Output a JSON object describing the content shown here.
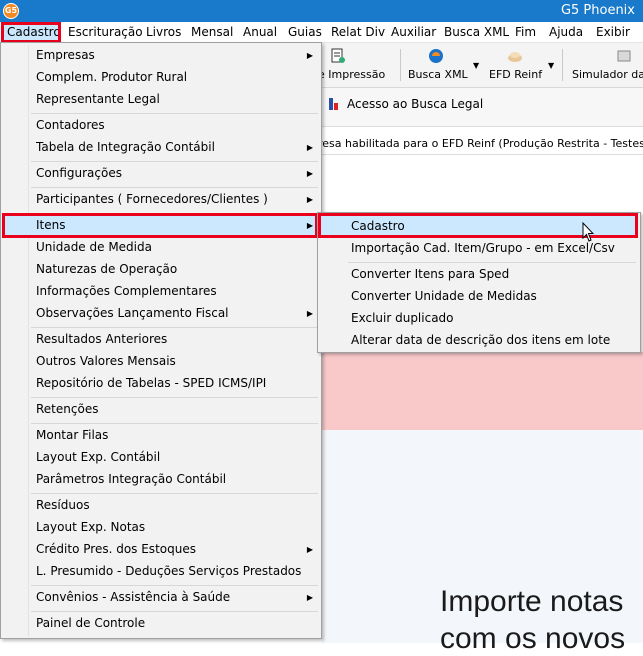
{
  "window": {
    "title": "G5 Phoenix",
    "app_icon_text": "G5"
  },
  "menubar": [
    {
      "label": "Cadastro",
      "active": true
    },
    {
      "label": "Escrituração"
    },
    {
      "label": "Livros"
    },
    {
      "label": "Mensal"
    },
    {
      "label": "Anual"
    },
    {
      "label": "Guias"
    },
    {
      "label": "Relat Div"
    },
    {
      "label": "Auxiliar"
    },
    {
      "label": "Busca XML"
    },
    {
      "label": "Fim"
    },
    {
      "label": "Ajuda"
    },
    {
      "label": "Exibir"
    }
  ],
  "toolbar": {
    "items": [
      {
        "label": "e Impressão",
        "icon": "print-setup-icon"
      },
      {
        "label": "Busca XML",
        "icon": "busca-xml-icon"
      },
      {
        "label": "EFD Reinf",
        "icon": "efd-reinf-icon"
      },
      {
        "label": "Simulador da R",
        "icon": "simulator-icon"
      }
    ],
    "busca_legal_label": "Acesso ao Busca Legal",
    "status_text": "resa habilitada para o EFD Reinf (Produção Restrita - Testes)"
  },
  "background": {
    "headline_line1": "Importe notas",
    "headline_line2": "com os novos"
  },
  "cadastro_menu": {
    "items": [
      {
        "label": "Empresas",
        "submenu": true
      },
      {
        "label": "Complem. Produtor Rural",
        "submenu": false
      },
      {
        "label": "Representante Legal",
        "submenu": false
      },
      {
        "label": "Contadores",
        "submenu": false
      },
      {
        "label": "Tabela de Integração Contábil",
        "submenu": true
      },
      {
        "label": "Configurações",
        "submenu": true
      },
      {
        "label": "Participantes ( Fornecedores/Clientes )",
        "submenu": true
      },
      {
        "label": "Itens",
        "submenu": true,
        "highlighted": true
      },
      {
        "label": "Unidade de Medida",
        "submenu": false
      },
      {
        "label": "Naturezas de Operação",
        "submenu": false
      },
      {
        "label": "Informações Complementares",
        "submenu": false
      },
      {
        "label": "Observações Lançamento Fiscal",
        "submenu": true
      },
      {
        "label": "Resultados Anteriores",
        "submenu": false
      },
      {
        "label": "Outros Valores Mensais",
        "submenu": false
      },
      {
        "label": "Repositório de Tabelas - SPED ICMS/IPI",
        "submenu": false
      },
      {
        "label": "Retenções",
        "submenu": false
      },
      {
        "label": "Montar Filas",
        "submenu": false
      },
      {
        "label": "Layout Exp. Contábil",
        "submenu": false
      },
      {
        "label": "Parâmetros Integração Contábil",
        "submenu": false
      },
      {
        "label": "Resíduos",
        "submenu": false
      },
      {
        "label": "Layout Exp. Notas",
        "submenu": false
      },
      {
        "label": "Crédito Pres. dos Estoques",
        "submenu": true
      },
      {
        "label": "L. Presumido - Deduções Serviços Prestados",
        "submenu": false
      },
      {
        "label": "Convênios - Assistência à Saúde",
        "submenu": true
      },
      {
        "label": "Painel de Controle",
        "submenu": false
      }
    ]
  },
  "itens_submenu": {
    "items": [
      {
        "label": "Cadastro",
        "highlighted": true
      },
      {
        "label": "Importação Cad. Item/Grupo - em Excel/Csv"
      },
      {
        "label": "Converter Itens para Sped"
      },
      {
        "label": "Converter Unidade de Medidas"
      },
      {
        "label": "Excluir duplicado"
      },
      {
        "label": "Alterar data de descrição dos itens em lote"
      }
    ]
  },
  "colors": {
    "titlebar": "#1979ca",
    "highlight": "#cce8ff",
    "annotation_red": "#e8001c",
    "menu_bg": "#f2f2f2"
  }
}
